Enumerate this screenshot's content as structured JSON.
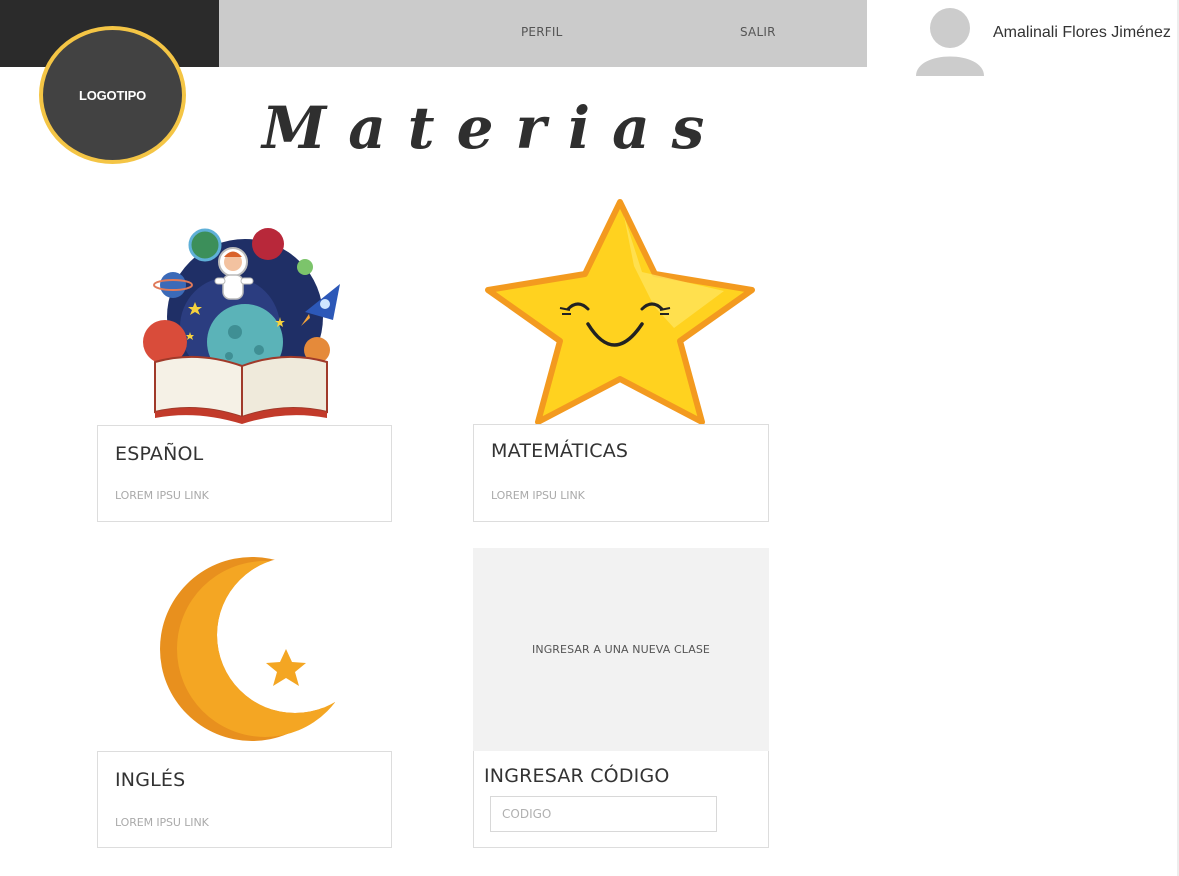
{
  "header": {
    "nav": {
      "profile_label": "PERFIL",
      "logout_label": "SALIR"
    },
    "logo_label": "LOGOTIPO",
    "user_name": "Amalinali Flores Jiménez",
    "colors": {
      "dark_bar": "#2b2b2b",
      "gray_bar": "#cbcbcb",
      "logo_fill": "#424242",
      "logo_ring": "#f4c545"
    }
  },
  "page": {
    "title": "Materias"
  },
  "subjects": [
    {
      "title": "ESPAÑOL",
      "link": "LOREM IPSU LINK",
      "image": "space-book-illustration"
    },
    {
      "title": "MATEMÁTICAS",
      "link": "LOREM IPSU LINK",
      "image": "smiling-star-illustration"
    },
    {
      "title": "INGLÉS",
      "link": "LOREM IPSU LINK",
      "image": "crescent-moon-star-illustration"
    }
  ],
  "join_class": {
    "panel_label": "INGRESAR A UNA NUEVA CLASE",
    "title": "INGRESAR CÓDIGO",
    "code_placeholder": "CODIGO"
  }
}
